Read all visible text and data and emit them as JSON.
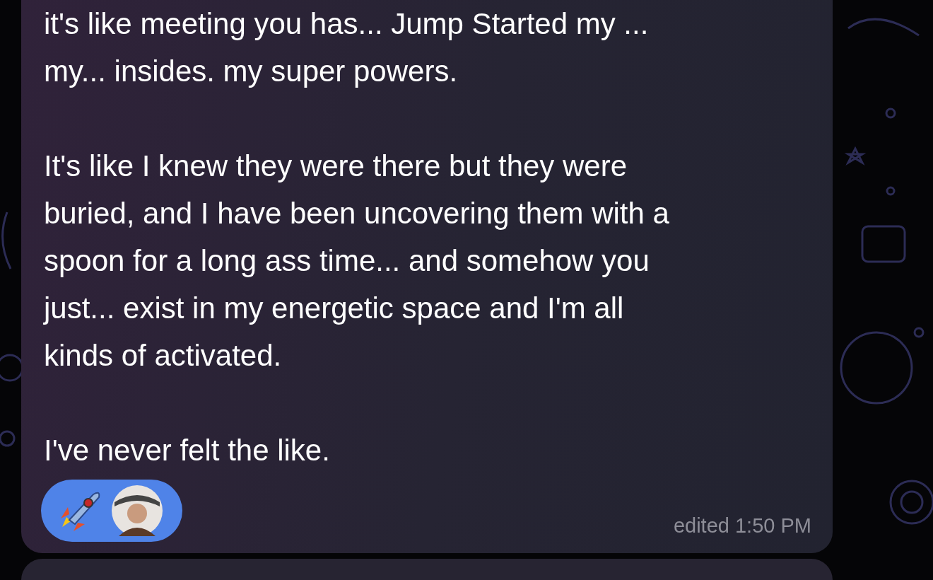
{
  "message": {
    "paragraphs": [
      {
        "lines": [
          "it's like meeting you has... Jump Started my ...",
          "my... insides. my super powers."
        ]
      },
      {
        "lines": [
          "It's like I knew they were there but they were",
          "buried, and I have been uncovering them with a",
          "spoon for a long ass time... and somehow you",
          "just... exist in my energetic space and I'm all",
          "kinds of activated."
        ]
      },
      {
        "lines": [
          "I've never felt the like."
        ]
      }
    ],
    "reaction": {
      "selected": true
    },
    "time": "edited 1:50 PM"
  }
}
